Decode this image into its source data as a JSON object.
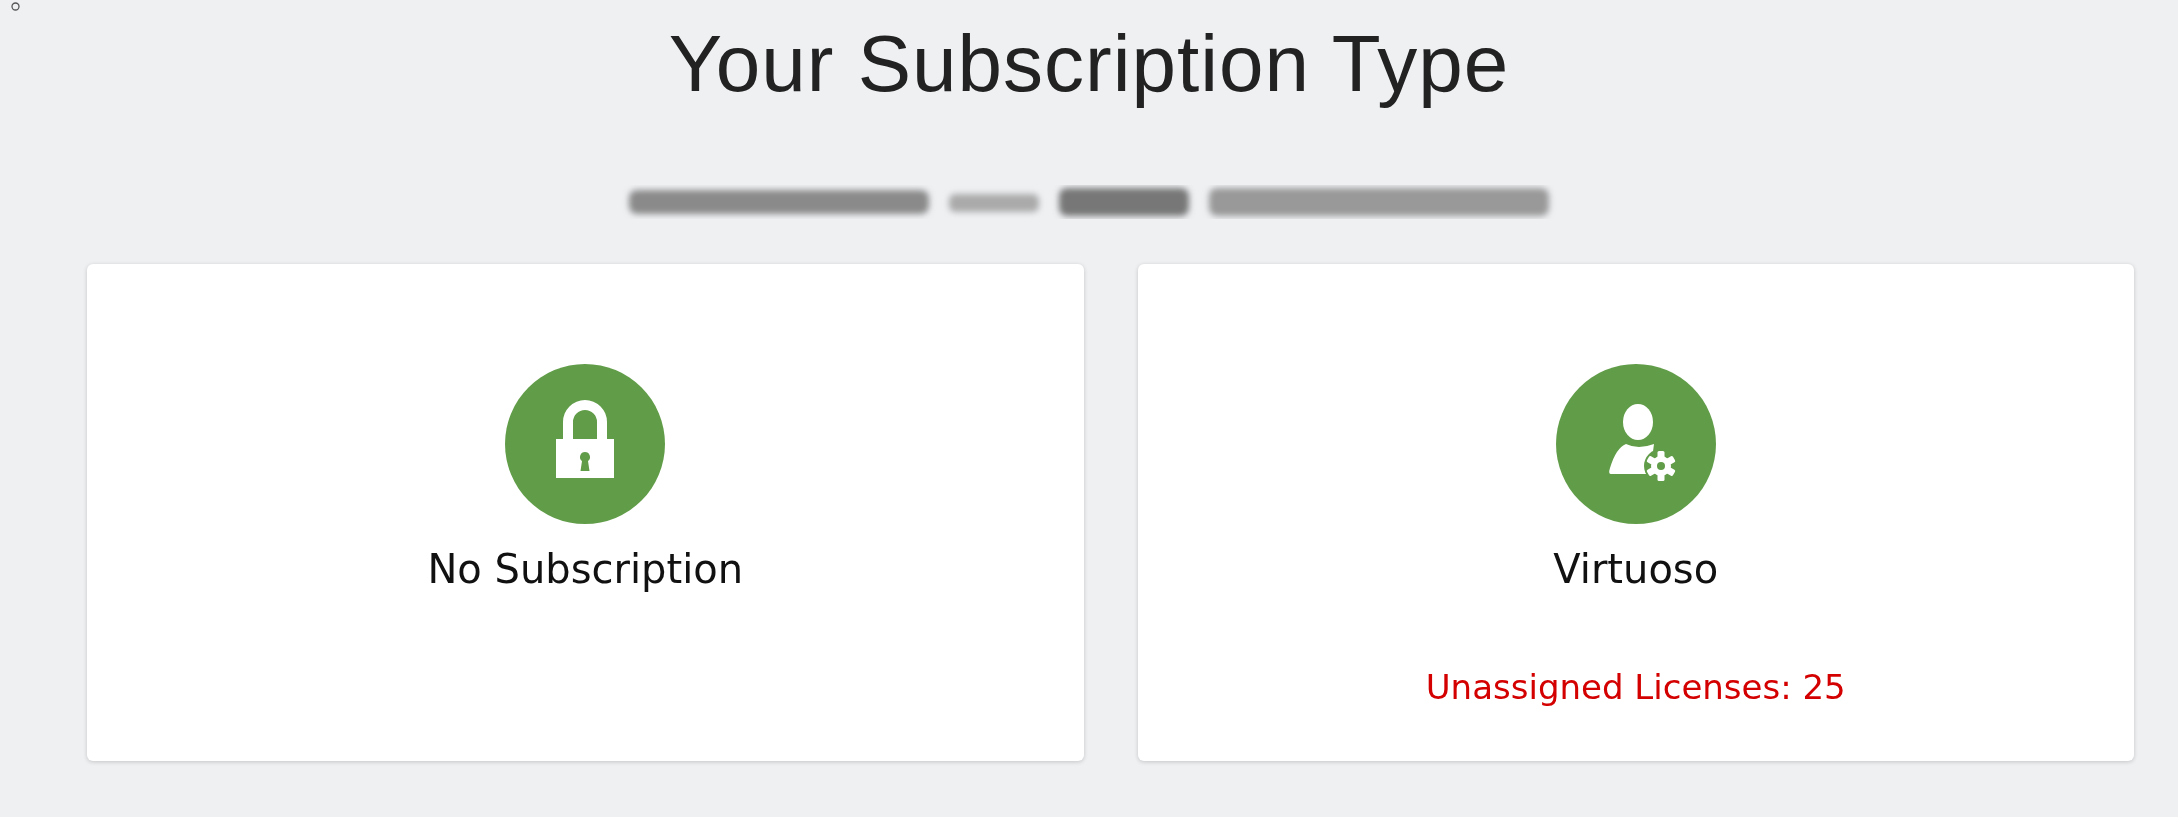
{
  "title": "Your Subscription Type",
  "cards": [
    {
      "kind": "lock",
      "name": "No Subscription"
    },
    {
      "kind": "user-gear",
      "name": "Virtuoso",
      "note": "Unassigned Licenses: 25"
    }
  ]
}
